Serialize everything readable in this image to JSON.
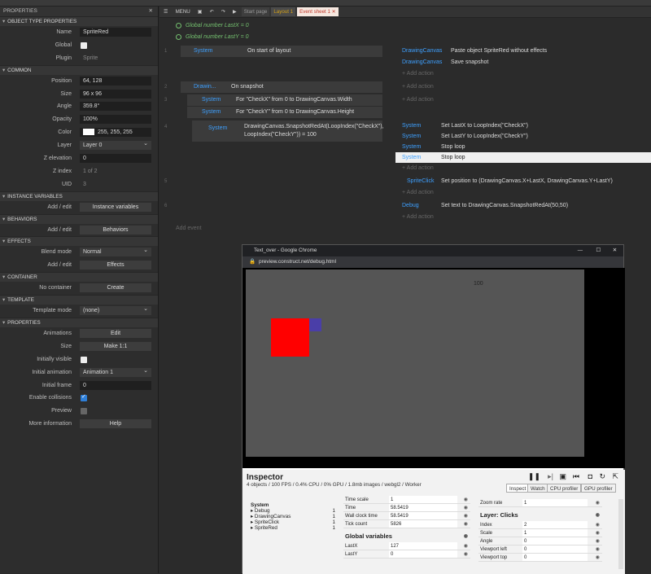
{
  "properties": {
    "header": "PROPERTIES",
    "close": "✕",
    "sections": {
      "object_type": "OBJECT TYPE PROPERTIES",
      "common": "COMMON",
      "instance_vars": "INSTANCE VARIABLES",
      "behaviors": "BEHAVIORS",
      "effects": "EFFECTS",
      "container": "CONTAINER",
      "template": "TEMPLATE",
      "properties": "PROPERTIES"
    },
    "name_label": "Name",
    "name_value": "SpriteRed",
    "global_label": "Global",
    "plugin_label": "Plugin",
    "plugin_value": "Sprite",
    "position_label": "Position",
    "position_value": "64, 128",
    "size_label": "Size",
    "size_value": "96 x 96",
    "angle_label": "Angle",
    "angle_value": "359.8°",
    "opacity_label": "Opacity",
    "opacity_value": "100%",
    "color_label": "Color",
    "color_value": "255, 255, 255",
    "layer_label": "Layer",
    "layer_value": "Layer 0",
    "zelev_label": "Z elevation",
    "zelev_value": "0",
    "zindex_label": "Z index",
    "zindex_value": "1 of 2",
    "uid_label": "UID",
    "uid_value": "3",
    "iv_add_label": "Add / edit",
    "iv_button": "Instance variables",
    "bh_add_label": "Add / edit",
    "bh_button": "Behaviors",
    "blend_label": "Blend mode",
    "blend_value": "Normal",
    "fx_add_label": "Add / edit",
    "fx_button": "Effects",
    "container_label": "No container",
    "container_button": "Create",
    "template_label": "Template mode",
    "template_value": "(none)",
    "anim_label": "Animations",
    "anim_button": "Edit",
    "psize_label": "Size",
    "psize_button": "Make 1:1",
    "visible_label": "Initially visible",
    "initanim_label": "Initial animation",
    "initanim_value": "Animation 1",
    "initframe_label": "Initial frame",
    "initframe_value": "0",
    "collisions_label": "Enable collisions",
    "preview_label": "Preview",
    "moreinfo_label": "More information",
    "moreinfo_button": "Help"
  },
  "toolbar": {
    "menu": "MENU",
    "start_page": "Start page",
    "layout_tab": "Layout 1",
    "event_tab": "Event sheet 1",
    "tab_close": "✕"
  },
  "events": {
    "gv1": "Global number LastX = 0",
    "gv2": "Global number LastY = 0",
    "e1_num": "1",
    "e1_obj": "System",
    "e1_cond": "On start of layout",
    "e1_a1_obj": "DrawingCanvas",
    "e1_a1": "Paste object SpriteRed without effects",
    "e1_a2_obj": "DrawingCanvas",
    "e1_a2": "Save snapshot",
    "add_action": "+ Add action",
    "e2_num": "2",
    "e2_obj": "Drawin...",
    "e2_cond": "On snapshot",
    "e3_num": "3",
    "e3_obj": "System",
    "e3_cond": "For \"CheckX\" from 0 to DrawingCanvas.Width",
    "e3b_obj": "System",
    "e3b_cond": "For \"CheckY\" from 0 to DrawingCanvas.Height",
    "e4_num": "4",
    "e4_obj": "System",
    "e4_cond": "DrawingCanvas.SnapshotRedAt(LoopIndex(\"CheckX\"), LoopIndex(\"CheckY\")) = 100",
    "e4_a1": "Set LastX to LoopIndex(\"CheckX\")",
    "e4_a2": "Set LastY to LoopIndex(\"CheckY\")",
    "e4_a3": "Stop loop",
    "e4_a4": "Stop loop",
    "e5_num": "5",
    "e5_obj": "SpriteClick",
    "e5_act": "Set position to (DrawingCanvas.X+LastX, DrawingCanvas.Y+LastY)",
    "e6_num": "6",
    "e6_obj": "Debug",
    "e6_act": "Set text to DrawingCanvas.SnapshotRedAt(50,50)",
    "add_event": "Add event"
  },
  "browser": {
    "title": "Text_over - Google Chrome",
    "url": "preview.construct.net/debug.html",
    "canvas_text": "100",
    "win_min": "—",
    "win_max": "☐",
    "win_close": "✕"
  },
  "inspector": {
    "title": "Inspector",
    "subtitle": "4 objects / 100 FPS / 0.4% CPU / 0% GPU / 1.8mb images / webgl2 / Worker",
    "tabs": [
      "Inspect",
      "Watch",
      "CPU profiler",
      "GPU profiler"
    ],
    "tree": [
      {
        "name": "System",
        "count": ""
      },
      {
        "name": "▸ Debug",
        "count": "1"
      },
      {
        "name": "▸ DrawingCanvas",
        "count": "1"
      },
      {
        "name": "▸ SpriteClick",
        "count": "1"
      },
      {
        "name": "▸ SpriteRed",
        "count": "1"
      }
    ],
    "sys_rows": [
      {
        "k": "Time scale",
        "v": "1"
      },
      {
        "k": "Time",
        "v": "58.5419"
      },
      {
        "k": "Wall clock time",
        "v": "58.5419"
      },
      {
        "k": "Tick count",
        "v": "5826"
      }
    ],
    "globals_header": "Global variables",
    "globals": [
      {
        "k": "LastX",
        "v": "127"
      },
      {
        "k": "LastY",
        "v": "0"
      }
    ],
    "zoom_k": "Zoom rate",
    "zoom_v": "1",
    "layer_header": "Layer: Clicks",
    "layer_rows": [
      {
        "k": "Index",
        "v": "2"
      },
      {
        "k": "Scale",
        "v": "1"
      },
      {
        "k": "Angle",
        "v": "0"
      },
      {
        "k": "Viewport left",
        "v": "0"
      },
      {
        "k": "Viewport top",
        "v": "0"
      }
    ]
  },
  "colors": {
    "accent": "#3ea0ff",
    "green": "#74c06f",
    "red_sprite": "#ff0000",
    "blue_sprite": "#4a3ea8",
    "tab_active": "#c0392b"
  }
}
